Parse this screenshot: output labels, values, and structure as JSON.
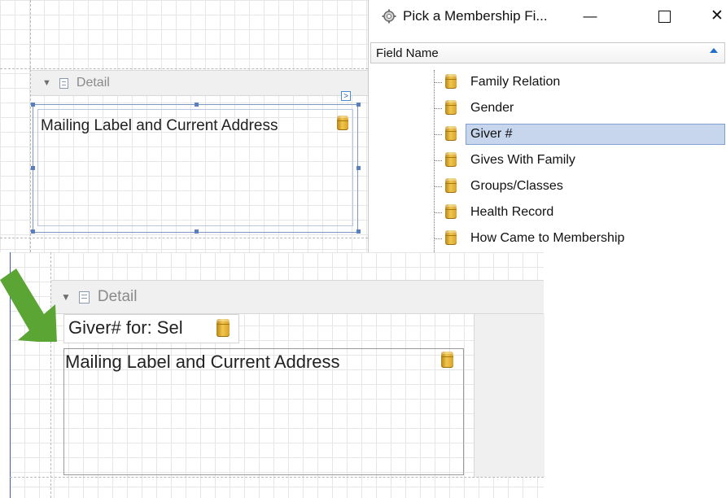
{
  "top_designer": {
    "band_label": "Detail",
    "smart_tag": ">",
    "field_text": "Mailing Label and Current Address"
  },
  "dialog": {
    "title": "Pick a Membership Fi...",
    "minimize_glyph": "—",
    "close_glyph": "✕",
    "column_header": "Field Name",
    "items": [
      {
        "label": "Family Relation",
        "selected": false
      },
      {
        "label": "Gender",
        "selected": false
      },
      {
        "label": "Giver #",
        "selected": true
      },
      {
        "label": "Gives With Family",
        "selected": false
      },
      {
        "label": "Groups/Classes",
        "selected": false
      },
      {
        "label": "Health Record",
        "selected": false
      },
      {
        "label": "How Came to Membership",
        "selected": false
      }
    ]
  },
  "bottom_designer": {
    "band_label": "Detail",
    "giver_field_text": "Giver# for: Sel",
    "address_field_text": "Mailing Label and Current Address"
  },
  "colors": {
    "selection_border": "#7f97c3",
    "handle": "#5a7fbf",
    "tree_selection": "#c7d6ec",
    "arrow_green": "#5aa534",
    "db_gold": "#f1c64c"
  },
  "icons": {
    "band_collapse": "triangle-down-icon",
    "band_doc": "document-icon",
    "field_db": "database-icon",
    "dialog_app": "gear-icon",
    "sort": "sort-ascending-icon"
  }
}
